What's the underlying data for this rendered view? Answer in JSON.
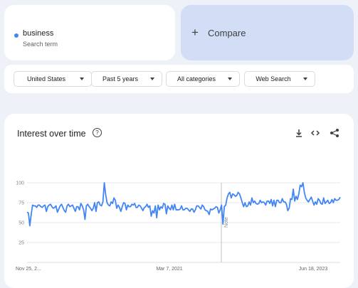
{
  "search_term": {
    "label": "business",
    "sublabel": "Search term",
    "color": "#4285f4"
  },
  "compare": {
    "label": "Compare"
  },
  "filters": [
    {
      "label": "United States"
    },
    {
      "label": "Past 5 years"
    },
    {
      "label": "All categories"
    },
    {
      "label": "Web Search"
    }
  ],
  "interest_card": {
    "title": "Interest over time",
    "icons": [
      "help-icon",
      "download-icon",
      "embed-icon",
      "share-icon"
    ]
  },
  "chart_data": {
    "type": "line",
    "title": "Interest over time",
    "xlabel": "",
    "ylabel": "",
    "ylim": [
      0,
      100
    ],
    "grid": true,
    "y_ticks": [
      "100",
      "75",
      "50",
      "25"
    ],
    "x_tick_labels": [
      "Nov 25, 2...",
      "Mar 7, 2021",
      "Jun 18, 2023"
    ],
    "annotation": "Note",
    "line_color": "#4285f4",
    "series": [
      {
        "values": [
          63,
          62,
          46,
          60,
          72,
          71,
          71,
          69,
          72,
          72,
          70,
          69,
          71,
          72,
          64,
          70,
          72,
          73,
          70,
          68,
          69,
          71,
          63,
          67,
          71,
          73,
          69,
          65,
          63,
          71,
          73,
          70,
          71,
          72,
          68,
          64,
          70,
          70,
          66,
          74,
          71,
          66,
          54,
          71,
          73,
          70,
          68,
          65,
          68,
          75,
          64,
          75,
          76,
          72,
          71,
          76,
          100,
          85,
          75,
          72,
          71,
          76,
          74,
          81,
          78,
          68,
          72,
          69,
          64,
          70,
          75,
          74,
          66,
          72,
          70,
          70,
          73,
          72,
          74,
          69,
          69,
          72,
          71,
          68,
          65,
          69,
          70,
          73,
          69,
          71,
          58,
          65,
          62,
          71,
          56,
          72,
          66,
          70,
          68,
          74,
          73,
          61,
          71,
          68,
          66,
          72,
          66,
          73,
          66,
          66,
          66,
          67,
          71,
          66,
          66,
          68,
          68,
          66,
          64,
          67,
          67,
          63,
          66,
          71,
          71,
          69,
          67,
          72,
          70,
          66,
          65,
          64,
          60,
          67,
          66,
          67,
          68,
          70,
          69,
          62,
          66,
          72,
          48,
          70,
          72,
          81,
          86,
          88,
          81,
          86,
          85,
          83,
          84,
          88,
          86,
          81,
          75,
          70,
          75,
          70,
          71,
          76,
          72,
          81,
          75,
          77,
          74,
          73,
          74,
          78,
          75,
          76,
          75,
          72,
          77,
          77,
          74,
          79,
          71,
          78,
          70,
          78,
          78,
          75,
          75,
          80,
          76,
          76,
          73,
          65,
          68,
          80,
          79,
          92,
          77,
          83,
          79,
          86,
          97,
          95,
          100,
          88,
          81,
          78,
          76,
          79,
          82,
          77,
          72,
          76,
          73,
          80,
          78,
          74,
          73,
          81,
          74,
          76,
          78,
          74,
          75,
          79,
          75,
          80,
          78,
          78,
          79,
          82
        ]
      }
    ]
  }
}
